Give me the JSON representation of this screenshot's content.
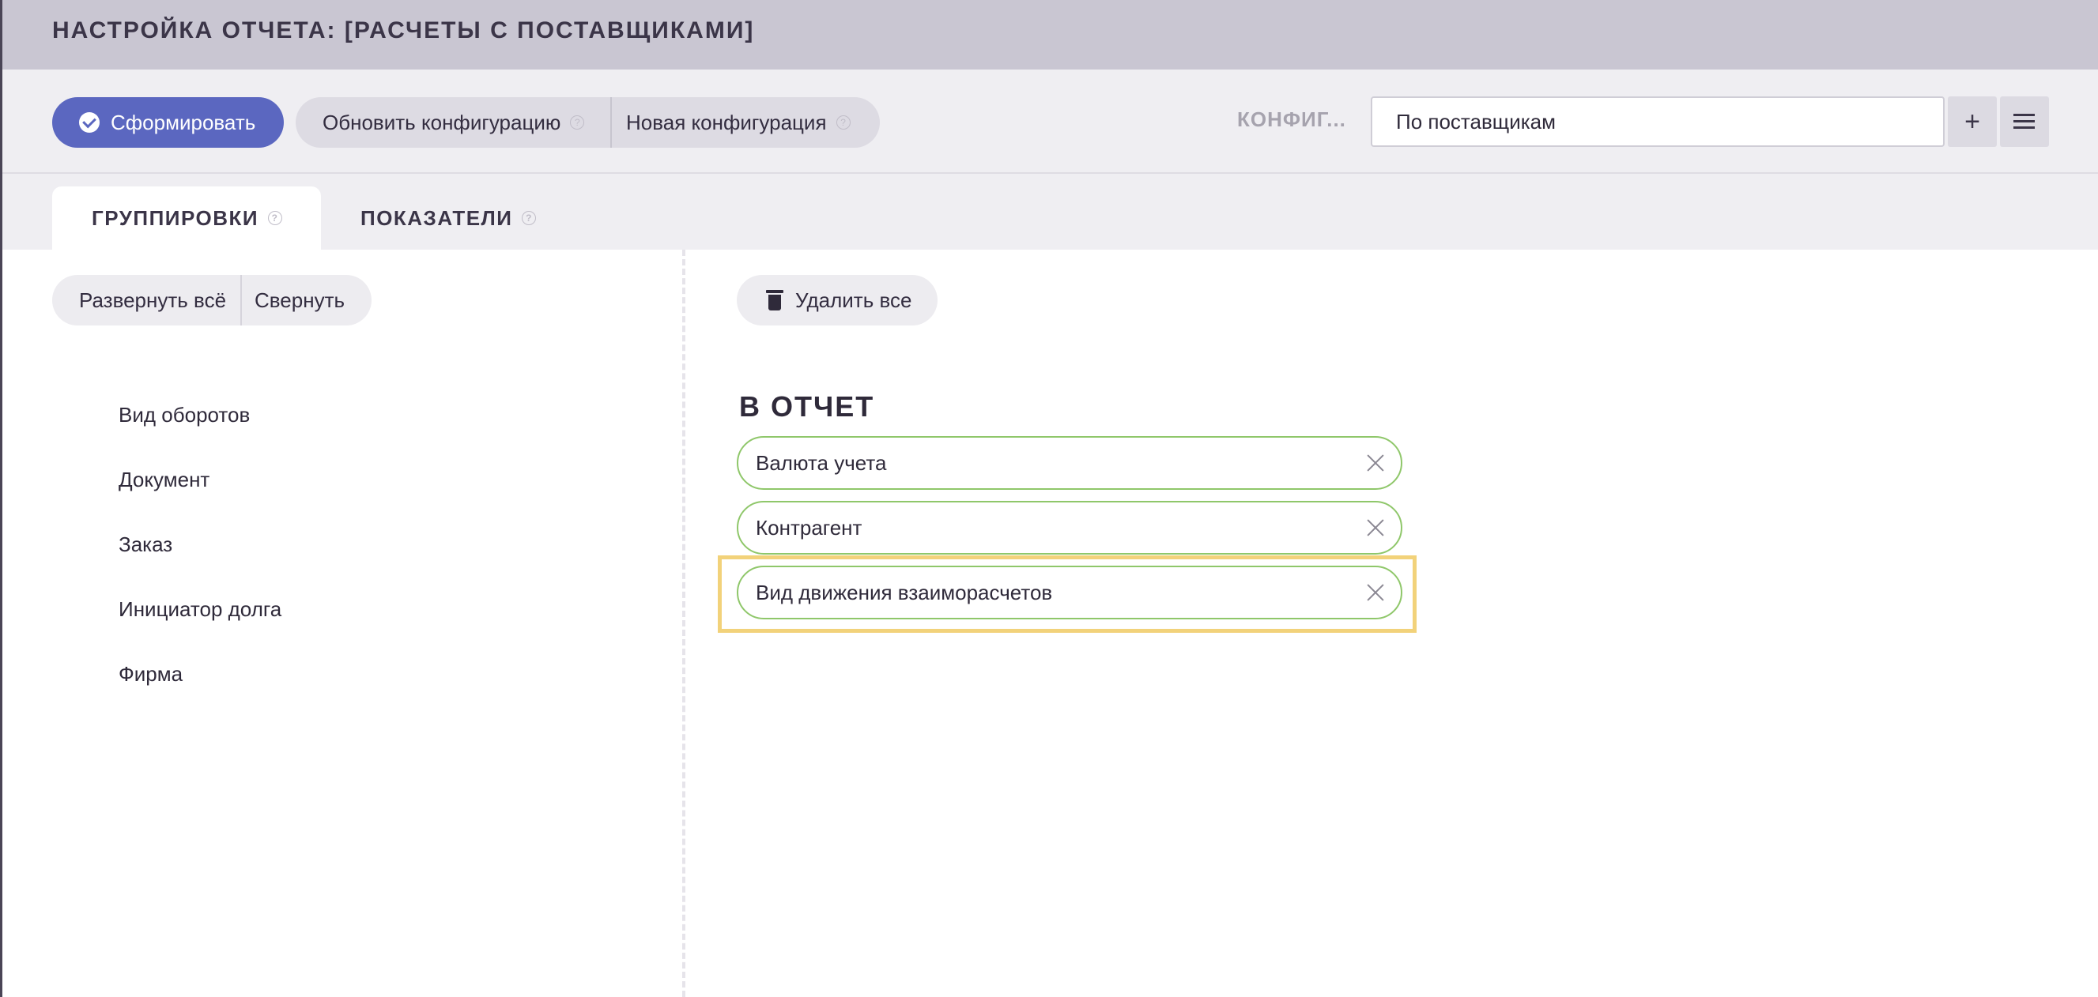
{
  "header": {
    "title": "НАСТРОЙКА ОТЧЕТА: [РАСЧЕТЫ С ПОСТАВЩИКАМИ]"
  },
  "toolbar": {
    "generate_label": "Сформировать",
    "update_config_label": "Обновить конфигурацию",
    "new_config_label": "Новая конфигурация",
    "config_label": "КОНФИГ...",
    "config_value": "По поставщикам",
    "add_label": "+",
    "help_glyph": "?"
  },
  "tabs": [
    {
      "label": "ГРУППИРОВКИ",
      "active": true
    },
    {
      "label": "ПОКАЗАТЕЛИ",
      "active": false
    }
  ],
  "left_panel": {
    "expand_all_label": "Развернуть всё",
    "collapse_label": "Свернуть",
    "items": [
      "Вид оборотов",
      "Документ",
      "Заказ",
      "Инициатор долга",
      "Фирма"
    ]
  },
  "right_panel": {
    "delete_all_label": "Удалить все",
    "section_title": "В ОТЧЕТ",
    "selected": [
      "Валюта учета",
      "Контрагент",
      "Вид движения взаиморасчетов"
    ]
  },
  "colors": {
    "primary": "#5b67c0",
    "header_bg": "#c9c6d2",
    "chip_border": "#8fc76a",
    "highlight": "#f2d27a"
  },
  "icons": {
    "generate": "check-circle-icon",
    "help": "question-circle-icon",
    "add": "plus-icon",
    "list": "list-icon",
    "delete": "trash-icon",
    "remove": "close-icon"
  }
}
